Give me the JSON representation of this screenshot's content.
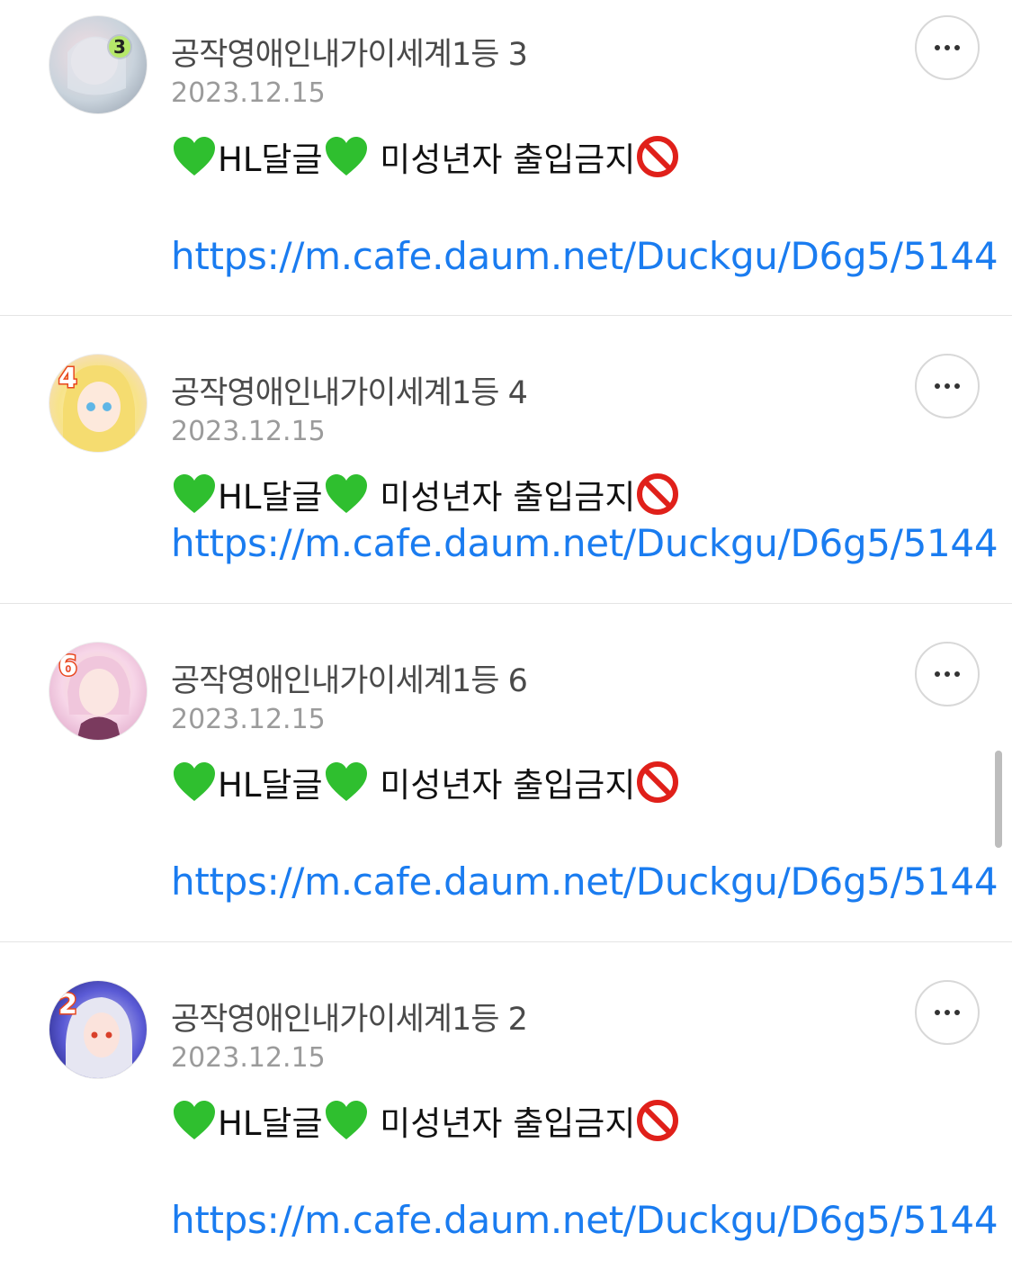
{
  "comments": [
    {
      "username": "공작영애인내가이세계1등 3",
      "date": "2023.12.15",
      "rank_badge": "3",
      "avatar_colors": [
        "#e8eef2",
        "#c9d3dc",
        "#f3dde2"
      ],
      "body_part1": "HL달글",
      "body_part2": " 미성년자 출입금지",
      "link": "https://m.cafe.daum.net/Duckgu/D6g5/5144"
    },
    {
      "username": "공작영애인내가이세계1등 4",
      "date": "2023.12.15",
      "rank_badge": "4",
      "avatar_colors": [
        "#fff6cc",
        "#f7e38a",
        "#f4d8e4"
      ],
      "body_part1": "HL달글",
      "body_part2": " 미성년자 출입금지",
      "link": "https://m.cafe.daum.net/Duckgu/D6g5/5144"
    },
    {
      "username": "공작영애인내가이세계1등 6",
      "date": "2023.12.15",
      "rank_badge": "6",
      "avatar_colors": [
        "#f7d6e8",
        "#e9b8d4",
        "#f6e6c8"
      ],
      "body_part1": "HL달글",
      "body_part2": " 미성년자 출입금지",
      "link": "https://m.cafe.daum.net/Duckgu/D6g5/5144"
    },
    {
      "username": "공작영애인내가이세계1등 2",
      "date": "2023.12.15",
      "rank_badge": "2",
      "avatar_colors": [
        "#2a2a8a",
        "#5b5bd6",
        "#d8d8f0"
      ],
      "body_part1": "HL달글",
      "body_part2": " 미성년자 출입금지",
      "link": "https://m.cafe.daum.net/Duckgu/D6g5/5144"
    }
  ],
  "icons": {
    "heart": "green-heart-icon",
    "no_entry": "no-entry-icon",
    "more": "more-options-icon"
  },
  "colors": {
    "link": "#1a7cf0",
    "heart": "#2fbf2f",
    "no_entry": "#e0201a"
  }
}
